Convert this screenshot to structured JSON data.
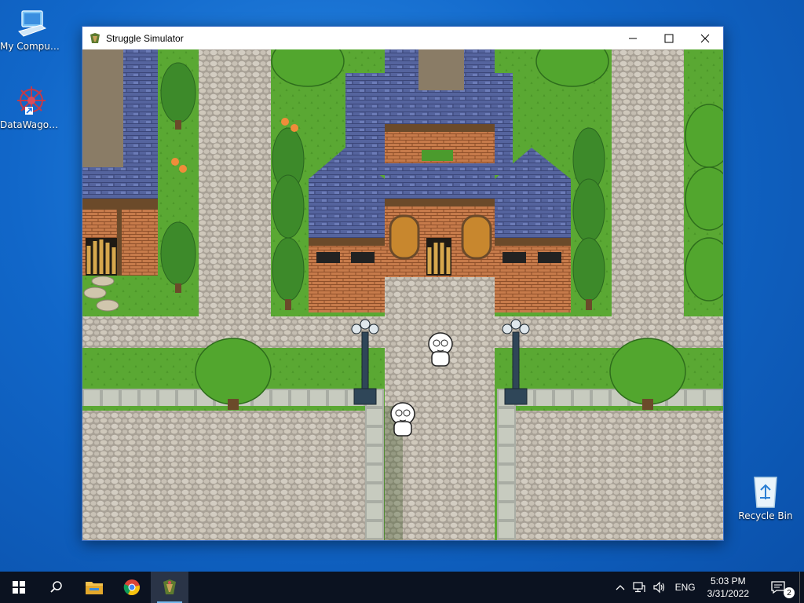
{
  "desktop": {
    "icons": [
      {
        "label": "My Computer"
      },
      {
        "label": "DataWagon..."
      },
      {
        "label": "Recycle Bin"
      }
    ]
  },
  "window": {
    "title": "Struggle Simulator",
    "controls": [
      "minimize-icon",
      "maximize-icon",
      "close-icon"
    ]
  },
  "game": {
    "scene": "town-square",
    "characters": [
      "white-blob-character",
      "white-blob-character"
    ]
  },
  "taskbar": {
    "apps": [
      "start-icon",
      "search-icon",
      "file-explorer-icon",
      "chrome-icon",
      "struggle-simulator-icon"
    ],
    "tray": {
      "language": "ENG",
      "time": "5:03 PM",
      "date": "3/31/2022",
      "notification_count": "2"
    }
  },
  "colors": {
    "desktop_bg": "#1167c9",
    "taskbar_bg": "#0b1220",
    "grass": "#5aa330",
    "cobblestone": "#b9b3a8",
    "roof": "#4d5f9c",
    "tree": "#3f8f2a"
  }
}
